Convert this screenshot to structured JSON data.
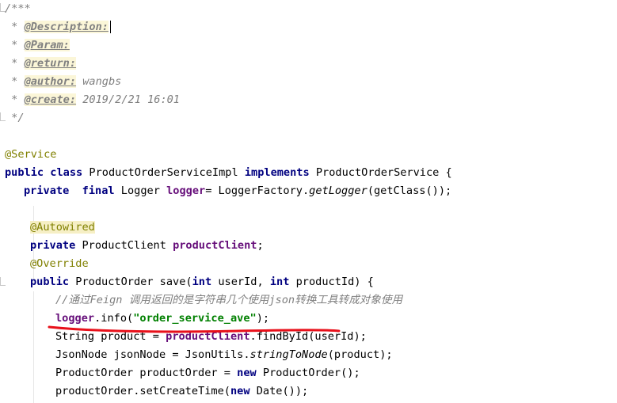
{
  "javadoc": {
    "open": "/***",
    "star": " * ",
    "description_tag": "@Description:",
    "param_tag": "@Param:",
    "return_tag": "@return:",
    "author_tag": "@author:",
    "author_value": " wangbs",
    "create_tag": "@create:",
    "create_value": " 2019/2/21 16:01",
    "close": " */"
  },
  "code": {
    "service_annotation": "@Service",
    "class_kw_public": "public",
    "class_kw_class": "class",
    "class_name": " ProductOrderServiceImpl ",
    "kw_implements": "implements",
    "interface_name": " ProductOrderService {",
    "kw_private": "private",
    "kw_final": "final",
    "logger_type": " Logger ",
    "logger_field": "logger",
    "logger_init_a": "= LoggerFactory.",
    "logger_init_method": "getLogger",
    "logger_init_b": "(getClass());",
    "autowired": "@Autowired",
    "client_type": " ProductClient ",
    "client_field": "productClient",
    "semicolon": ";",
    "override": "@Override",
    "save_sig_a": " ProductOrder save(",
    "kw_int": "int",
    "save_sig_b": " userId, ",
    "save_sig_c": " productId) {",
    "comment_line": "//通过Feign 调用返回的是字符串几个使用json转换工具转成对象使用",
    "logger_call_field": "logger",
    "logger_call_a": ".info(",
    "logger_call_str": "\"order_service_ave\"",
    "logger_call_b": ");",
    "string_line_a": "String product = ",
    "string_line_field": "productClient",
    "string_line_b": ".findById(userId);",
    "json_line_a": "JsonNode jsonNode = JsonUtils.",
    "json_line_method": "stringToNode",
    "json_line_b": "(product);",
    "order_line_a": "ProductOrder productOrder = ",
    "kw_new": "new",
    "order_line_b": " ProductOrder();",
    "settime_line_a": "productOrder.setCreateTime(",
    "settime_line_b": " Date());"
  },
  "colors": {
    "keyword": "#000080",
    "annotation": "#808000",
    "field": "#660e7a",
    "string": "#008000",
    "comment": "#808080",
    "underline": "#e8101a"
  }
}
